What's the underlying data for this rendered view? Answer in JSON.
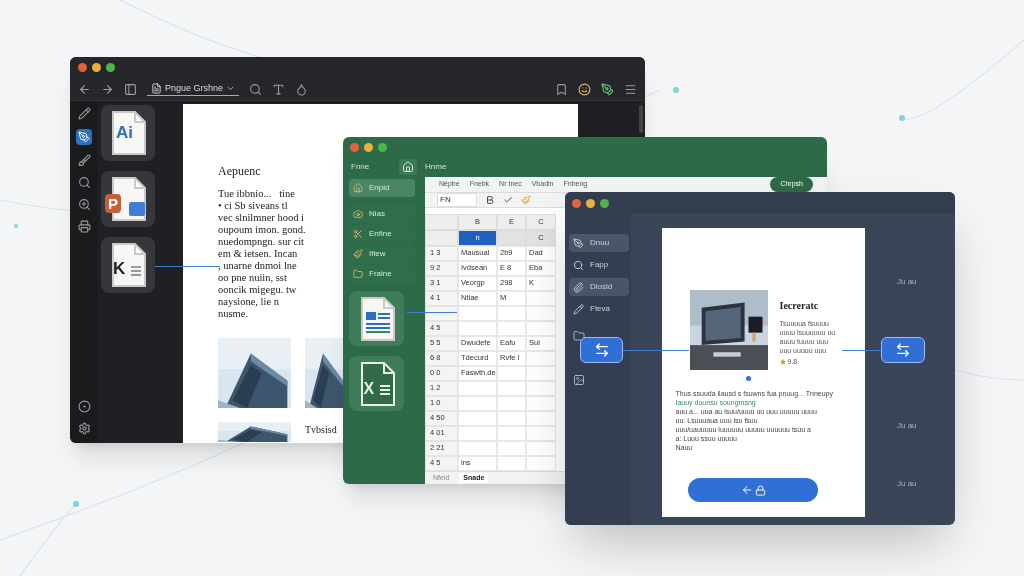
{
  "doc_window": {
    "toolbar_dropdown": "Pngue Grshne",
    "file_tiles": [
      {
        "kind": "ai",
        "letter": "Ai"
      },
      {
        "kind": "ppt",
        "letter": "P"
      },
      {
        "kind": "doc",
        "letter": "K"
      }
    ],
    "page": {
      "heading": "Aepuenc",
      "lines": [
        "Tue ibbnio...   tine",
        "• ci Sb siveans tl",
        "vec slnilmner hood i",
        "oupoum imon. gond.",
        "nuedompngn. sur cit",
        "em & ietsen. Incan",
        ", unarne dnmoi lne",
        "oo pne nuiin, sst",
        "ooncik migegu. tw",
        "naysione, lie n",
        "nusme."
      ],
      "caption": "Tvbsisd"
    }
  },
  "sheet_window": {
    "home_label": "Fnne",
    "breadcrumb": "Hnme",
    "sidebar": [
      {
        "label": "Enpid",
        "selected": true
      },
      {
        "label": "Nias",
        "selected": false
      },
      {
        "label": "Enfine",
        "selected": false
      },
      {
        "label": "Ifiew",
        "selected": false
      },
      {
        "label": "Fraine",
        "selected": false
      }
    ],
    "file_tiles": [
      {
        "kind": "word"
      },
      {
        "kind": "excel",
        "letter": "X"
      }
    ],
    "ribbon_tabs": [
      "Népbe",
      "Fnebk",
      "Nr tnec",
      "Vbadin",
      "Fnbeng"
    ],
    "share_button": "Chrpsh",
    "font_box": "FN",
    "columns": [
      "B",
      "E",
      "C"
    ],
    "header_row": [
      {
        "label": "n",
        "selected": true
      },
      {
        "selected": false
      },
      {
        "label": "C",
        "selected": false
      }
    ],
    "rows": [
      {
        "header": "1 3",
        "cells": [
          "Mausual",
          "2b9",
          "Dad"
        ]
      },
      {
        "header": "9 2",
        "cells": [
          "Ivdsean",
          "E 8",
          "Eba"
        ]
      },
      {
        "header": "3 1",
        "cells": [
          "Veorgp",
          "298",
          "K"
        ]
      },
      {
        "header": "4 1",
        "cells": [
          "Ntiae",
          "M",
          ""
        ]
      },
      {
        "header": "",
        "cells": [
          "",
          "",
          ""
        ]
      },
      {
        "header": "4 5",
        "cells": [
          "",
          "",
          ""
        ]
      },
      {
        "header": "5 5",
        "cells": [
          "Dwudefe",
          "Eafu",
          "Sui"
        ]
      },
      {
        "header": "6 8",
        "cells": [
          "Tdecurd",
          "Rvfe I",
          ""
        ]
      },
      {
        "header": "0 0",
        "cells": [
          "Faswth.de",
          "",
          ""
        ]
      },
      {
        "header": "1 2",
        "cells": [
          "",
          "",
          ""
        ]
      },
      {
        "header": "1 0",
        "cells": [
          "",
          "",
          ""
        ]
      },
      {
        "header": "4 50",
        "cells": [
          "",
          "",
          ""
        ]
      },
      {
        "header": "4 01",
        "cells": [
          "",
          "",
          ""
        ]
      },
      {
        "header": "2 21",
        "cells": [
          "",
          "",
          ""
        ]
      },
      {
        "header": "4 5",
        "cells": [
          "ins",
          "",
          ""
        ]
      }
    ],
    "sheet_tabs": [
      {
        "label": "Nfeid",
        "selected": false
      },
      {
        "label": "Snade",
        "selected": true
      }
    ]
  },
  "viewer_window": {
    "sidebar": [
      {
        "label": "Dnuu",
        "selected": true
      },
      {
        "label": "Fapp",
        "selected": false
      },
      {
        "label": "Dlosid",
        "selected": true
      },
      {
        "label": "Fteva",
        "selected": false
      }
    ],
    "page": {
      "heading": "Iecreratc",
      "intro": [
        "Tsuuuua fsuuuu",
        "uuuu lsuuuuuu uu",
        "auuu tuuuu uuu",
        "uuu uuuuu uuu"
      ],
      "rating": "9.8",
      "lines": [
        "Thus ssuuda ilausd s fsuwns fua pnuug... Tnneupy",
        "Iauuy dounsu soungmsng",
        "auu a... uua au lsuu/uuuu uu uuu uuuuu uuuu",
        "uu: Lsuuuaua uuu lsu fsuu",
        "uuu/uauuuuu luuuuuu uuuuu uuuuuu tsuu a",
        "a: Luuu ssuu uuuuu",
        "Nauu"
      ]
    },
    "side_labels": [
      "Ju au",
      "Ju au",
      "Ju au"
    ]
  }
}
